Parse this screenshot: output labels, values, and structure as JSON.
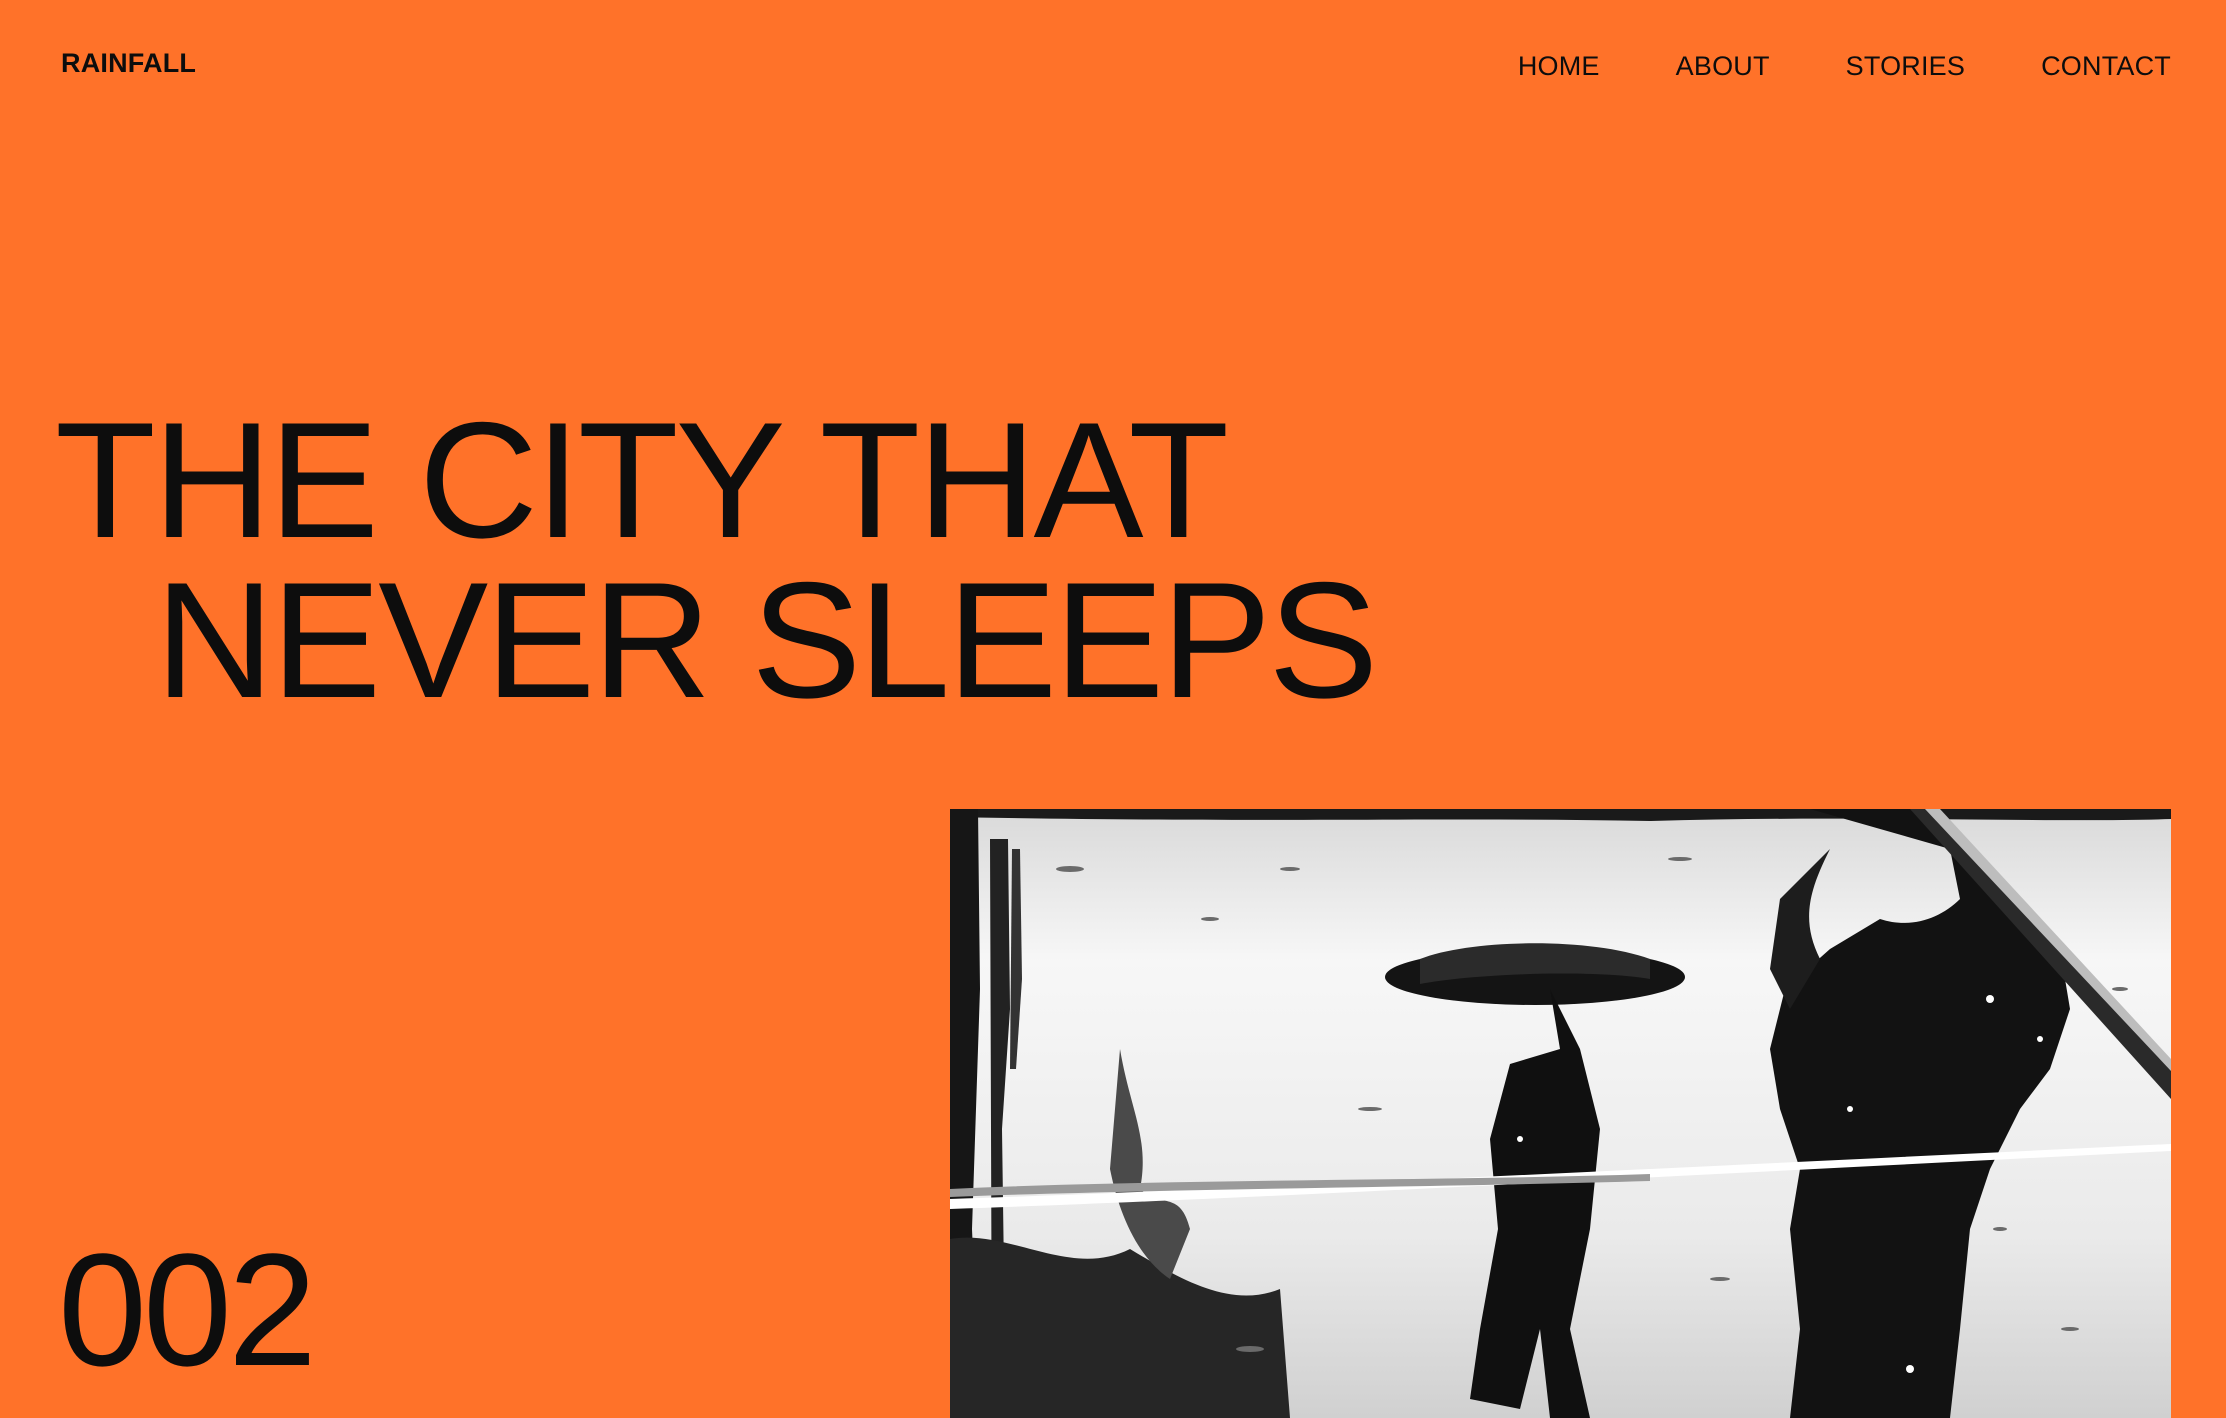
{
  "header": {
    "brand": "RAINFALL",
    "nav": [
      {
        "label": "HOME"
      },
      {
        "label": "ABOUT"
      },
      {
        "label": "STORIES"
      },
      {
        "label": "CONTACT"
      }
    ]
  },
  "hero": {
    "title_line1": "THE CITY THAT",
    "title_line2": "NEVER SLEEPS",
    "issue_number": "002"
  },
  "colors": {
    "background": "#ff7229",
    "text": "#0d0d0d"
  },
  "image": {
    "description_icon": "rain-street-photo-icon"
  }
}
